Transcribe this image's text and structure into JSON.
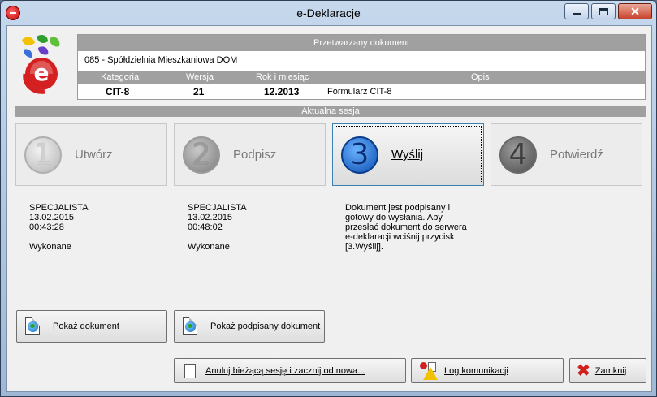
{
  "window": {
    "title": "e-Deklaracje"
  },
  "document_panel": {
    "header": "Przetwarzany dokument",
    "name": "085 - Spółdzielnia Mieszkaniowa DOM",
    "columns": {
      "category": "Kategoria",
      "version": "Wersja",
      "year_month": "Rok i miesiąc",
      "description": "Opis"
    },
    "values": {
      "category": "CIT-8",
      "version": "21",
      "year_month": "12.2013",
      "description": "Formularz CIT-8"
    }
  },
  "session": {
    "header": "Aktualna sesja",
    "steps": [
      {
        "number": "1",
        "label": "Utwórz"
      },
      {
        "number": "2",
        "label": "Podpisz"
      },
      {
        "number": "3",
        "label": "Wyślij"
      },
      {
        "number": "4",
        "label": "Potwierdź"
      }
    ],
    "step1_info": "SPECJALISTA\n13.02.2015\n00:43:28\n\nWykonane",
    "step2_info": "SPECJALISTA\n13.02.2015\n00:48:02\n\nWykonane",
    "step3_info": "Dokument jest podpisany i\ngotowy do wysłania. Aby\nprzesłać dokument do serwera\ne-deklaracji wciśnij przycisk\n[3.Wyślij]."
  },
  "buttons": {
    "show_document": "Pokaż dokument",
    "show_signed_document": "Pokaż podpisany dokument",
    "cancel_session": "Anuluj bieżącą sesję i zacznij od nowa...",
    "communication_log": "Log komunikacji",
    "close": "Zamknij"
  },
  "colors": {
    "active_step": "#0a4fb3",
    "header_bar": "#a0a0a0"
  }
}
